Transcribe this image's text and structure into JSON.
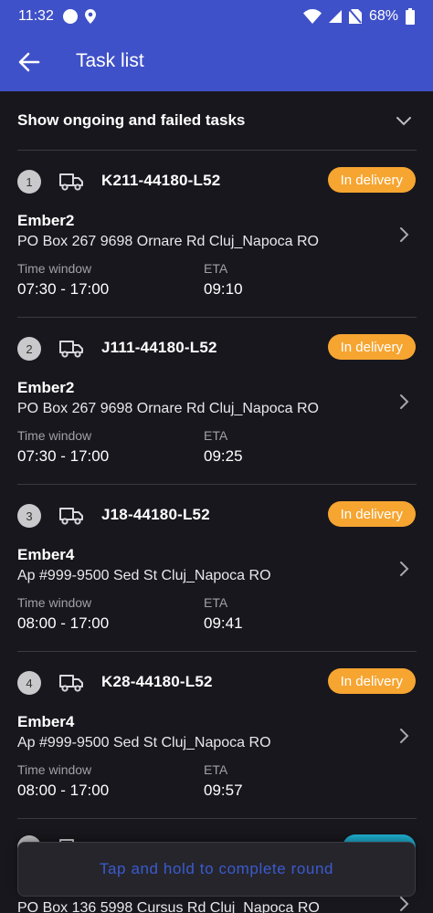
{
  "status_bar": {
    "time": "11:32",
    "battery": "68%"
  },
  "app_bar": {
    "title": "Task list"
  },
  "filter": {
    "label": "Show ongoing and failed tasks"
  },
  "tasks": [
    {
      "number": "1",
      "code": "K211-44180-L52",
      "status": "In delivery",
      "name": "Ember2",
      "address": "PO Box 267 9698 Ornare Rd Cluj_Napoca RO",
      "time_window_label": "Time window",
      "time_window": "07:30 - 17:00",
      "eta_label": "ETA",
      "eta": "09:10"
    },
    {
      "number": "2",
      "code": "J111-44180-L52",
      "status": "In delivery",
      "name": "Ember2",
      "address": "PO Box 267 9698 Ornare Rd Cluj_Napoca RO",
      "time_window_label": "Time window",
      "time_window": "07:30 - 17:00",
      "eta_label": "ETA",
      "eta": "09:25"
    },
    {
      "number": "3",
      "code": "J18-44180-L52",
      "status": "In delivery",
      "name": "Ember4",
      "address": "Ap #999-9500 Sed St Cluj_Napoca RO",
      "time_window_label": "Time window",
      "time_window": "08:00 - 17:00",
      "eta_label": "ETA",
      "eta": "09:41"
    },
    {
      "number": "4",
      "code": "K28-44180-L52",
      "status": "In delivery",
      "name": "Ember4",
      "address": "Ap #999-9500 Sed St Cluj_Napoca RO",
      "time_window_label": "Time window",
      "time_window": "08:00 - 17:00",
      "eta_label": "ETA",
      "eta": "09:57"
    }
  ],
  "partial_task": {
    "address": "PO Box 136 5998 Cursus Rd Cluj_Napoca RO"
  },
  "complete_round": {
    "label": "Tap and hold to complete round"
  },
  "colors": {
    "primary": "#3f51c8",
    "background": "#18171d",
    "status_in_delivery": "#f6a531",
    "status_other": "#1fb5d6",
    "complete_text": "#3a5bd0"
  }
}
